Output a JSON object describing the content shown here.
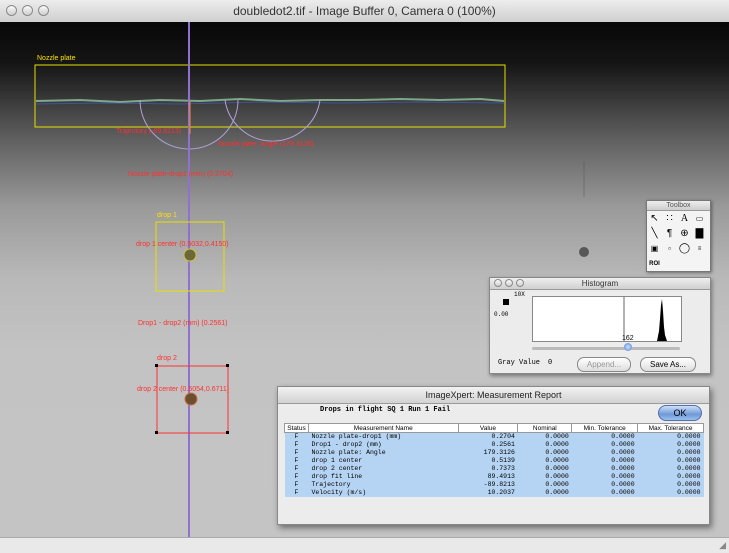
{
  "main_window": {
    "title": "doubledot2.tif - Image Buffer 0, Camera 0  (100%)"
  },
  "overlay": {
    "nozzle_plate_label": "Nozzle plate",
    "trajectory_label": "Trajectory (-89.8213)",
    "nozzle_plate_angle_label": "Nozzle plate: Angle (179.3126)",
    "nozzle_drop1_label": "Nozzle plate-drop1 (mm) (0.2704)",
    "drop1_label": "drop 1",
    "drop1_center_label": "drop 1 center (0.5032,0.4150)",
    "drop_distance_label": "Drop1 - drop2 (mm) (0.2561)",
    "drop2_label": "drop 2",
    "drop2_center_label": "drop 2 center (0.5054,0.6711)"
  },
  "toolbox": {
    "title": "Toolbox",
    "roi_label": "ROI"
  },
  "histogram": {
    "title": "Histogram",
    "y_max_label": "10X",
    "y_zero_label": "0.00",
    "slider_value": "162",
    "gray_value_label": "Gray Value",
    "gray_value": "0",
    "append_button": "Append...",
    "save_button": "Save As..."
  },
  "report": {
    "title": "ImageXpert: Measurement Report",
    "summary": "Drops in flight SQ  1 Run  1 Fail",
    "ok_button": "OK",
    "columns": [
      "Status",
      "Measurement Name",
      "Value",
      "Nominal",
      "Min. Tolerance",
      "Max. Tolerance"
    ],
    "rows": [
      {
        "status": "F",
        "name": "Nozzle plate-drop1 (mm)",
        "value": "0.2704",
        "nominal": "0.0000",
        "min": "0.0000",
        "max": "0.0000"
      },
      {
        "status": "F",
        "name": "Drop1 - drop2 (mm)",
        "value": "0.2561",
        "nominal": "0.0000",
        "min": "0.0000",
        "max": "0.0000"
      },
      {
        "status": "F",
        "name": "Nozzle plate: Angle",
        "value": "179.3126",
        "nominal": "0.0000",
        "min": "0.0000",
        "max": "0.0000"
      },
      {
        "status": "F",
        "name": "drop 1 center",
        "value": "0.5139",
        "nominal": "0.0000",
        "min": "0.0000",
        "max": "0.0000"
      },
      {
        "status": "F",
        "name": "drop 2 center",
        "value": "0.7373",
        "nominal": "0.0000",
        "min": "0.0000",
        "max": "0.0000"
      },
      {
        "status": "F",
        "name": "drop fit line",
        "value": "89.4913",
        "nominal": "0.0000",
        "min": "0.0000",
        "max": "0.0000"
      },
      {
        "status": "F",
        "name": "Trajectory",
        "value": "-89.8213",
        "nominal": "0.0000",
        "min": "0.0000",
        "max": "0.0000"
      },
      {
        "status": "F",
        "name": "Velocity (m/s)",
        "value": "10.2037",
        "nominal": "0.0000",
        "min": "0.0000",
        "max": "0.0000"
      }
    ]
  }
}
